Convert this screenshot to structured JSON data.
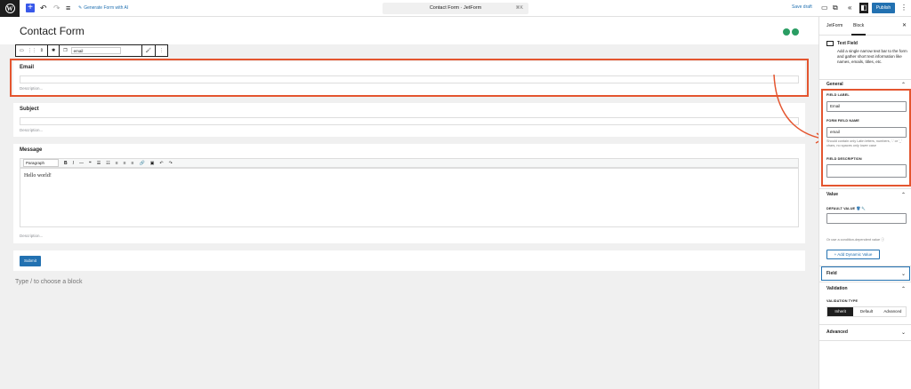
{
  "toolbar": {
    "generate_label": "Generate Form with AI",
    "doc_title": "Contact Form · JetForm",
    "shortcut": "⌘K",
    "save_draft": "Save draft",
    "publish": "Publish"
  },
  "editor": {
    "page_title": "Contact Form",
    "block_toolbar_field_name": "email",
    "fields": [
      {
        "label": "Email",
        "desc": "Description..."
      },
      {
        "label": "Subject",
        "desc": "Description..."
      },
      {
        "label": "Message",
        "desc": "Description..."
      }
    ],
    "rte": {
      "paragraph": "Paragraph",
      "content": "Hello world!"
    },
    "submit_label": "Submit",
    "choose_block": "Type / to choose a block"
  },
  "sidebar": {
    "tabs": [
      "JetForm",
      "Block"
    ],
    "active_tab": "Block",
    "block_title": "Text Field",
    "block_desc": "Add a single narrow text bar to the form and gather short text information like names, emails, titles, etc.",
    "general": {
      "title": "General",
      "field_label_label": "FIELD LABEL",
      "field_label_value": "Email",
      "field_name_label": "FORM FIELD NAME",
      "field_name_value": "email",
      "field_name_help": "Should contain only Latin letters, numbers, '-' or '_' chars, no spaces only lower case",
      "field_desc_label": "FIELD DESCRIPTION",
      "field_desc_value": ""
    },
    "value": {
      "title": "Value",
      "default_label": "DEFAULT VALUE",
      "default_value": "",
      "condition_text": "Or use a condition-dependent value",
      "add_dynamic": "Add Dynamic Value"
    },
    "field_panel": "Field",
    "validation": {
      "title": "Validation",
      "type_label": "VALIDATION TYPE",
      "options": [
        "Inherit",
        "Default",
        "Advanced"
      ],
      "selected": "Inherit"
    },
    "advanced_panel": "Advanced"
  },
  "colors": {
    "accent": "#2271b1",
    "highlight": "#e4552f",
    "wp_blue": "#3858e9"
  }
}
